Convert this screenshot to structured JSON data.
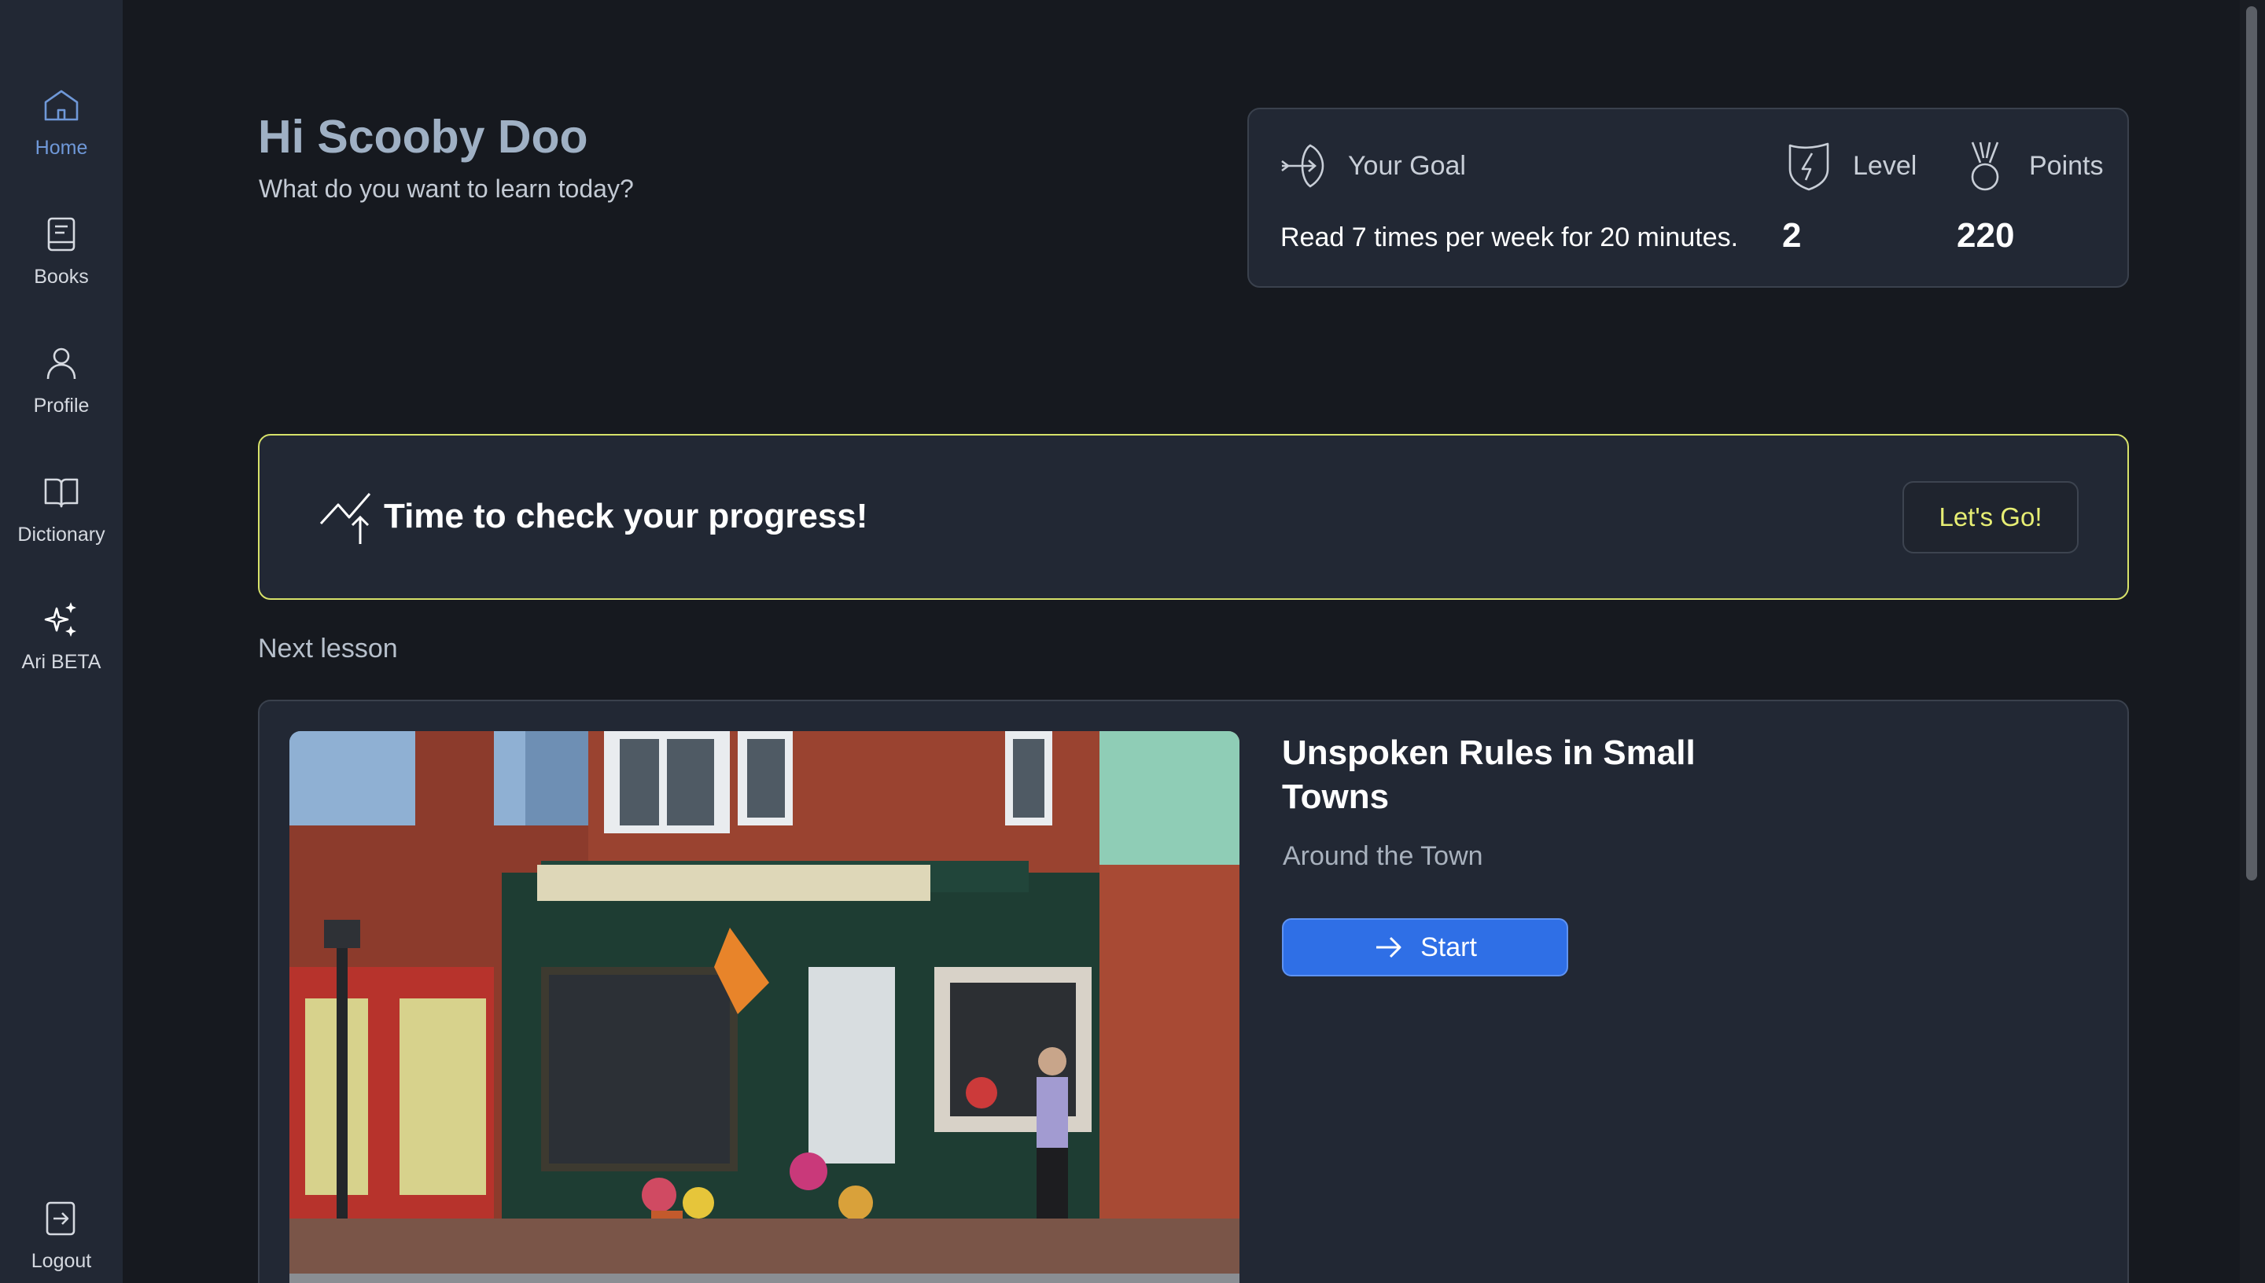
{
  "sidebar": {
    "items": [
      {
        "label": "Home",
        "icon": "home-icon",
        "active": true
      },
      {
        "label": "Books",
        "icon": "book-icon"
      },
      {
        "label": "Profile",
        "icon": "user-icon"
      },
      {
        "label": "Dictionary",
        "icon": "open-book-icon"
      },
      {
        "label": "Ari BETA",
        "icon": "sparkles-icon"
      }
    ],
    "logout": {
      "label": "Logout",
      "icon": "logout-icon"
    }
  },
  "greeting": {
    "title": "Hi Scooby Doo",
    "subtitle": "What do you want to learn today?"
  },
  "stats": {
    "goal_label": "Your Goal",
    "goal_text": "Read 7 times per week for 20 minutes.",
    "level_label": "Level",
    "level_value": "2",
    "points_label": "Points",
    "points_value": "220"
  },
  "progress": {
    "title": "Time to check your progress!",
    "button": "Let's Go!"
  },
  "next_lesson": {
    "section_label": "Next lesson",
    "title": "Unspoken Rules in Small Towns",
    "subtitle": "Around the Town",
    "start_label": "Start"
  },
  "colors": {
    "background": "#16191f",
    "panel": "#222834",
    "accent_active": "#6f98d8",
    "banner_border": "#d7e26a",
    "lets_go_text": "#e7ee74",
    "primary_button": "#2f6fe6"
  }
}
